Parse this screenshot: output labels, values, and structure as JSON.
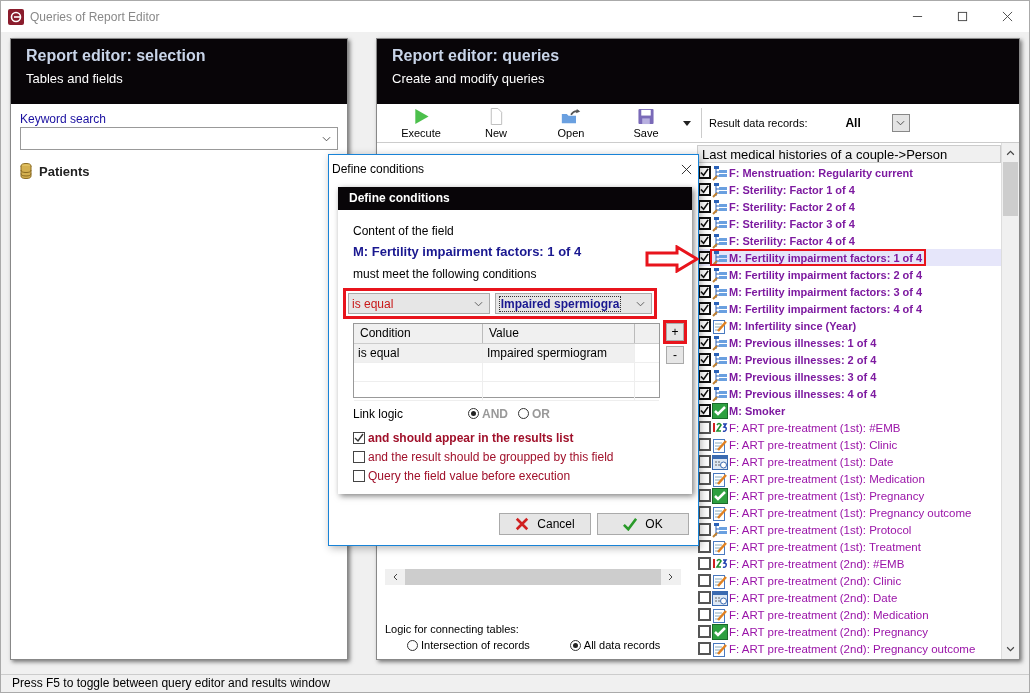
{
  "window": {
    "title": "Queries of Report Editor"
  },
  "selection_panel": {
    "title": "Report editor: selection",
    "subtitle": "Tables and fields",
    "keyword_search": {
      "label": "Keyword search"
    },
    "tables": [
      {
        "label": "Patients"
      }
    ]
  },
  "queries_panel": {
    "title": "Report editor: queries",
    "subtitle": "Create and modify queries",
    "toolbar": [
      {
        "label": "Execute",
        "kind": "run"
      },
      {
        "label": "New",
        "kind": "new"
      },
      {
        "label": "Open",
        "kind": "open"
      },
      {
        "label": "Save",
        "kind": "save"
      }
    ],
    "result_records": {
      "label": "Result data records:",
      "value": "All"
    },
    "connect_logic": {
      "label": "Logic for connecting tables:",
      "options": [
        {
          "label": "Intersection of records",
          "selected": false
        },
        {
          "label": "All data records",
          "selected": true
        }
      ]
    },
    "field_list": {
      "header": "Last medical histories of a couple->Person",
      "items": [
        {
          "label": "F: Menstruation: Regularity current",
          "kind": "list",
          "checked": true,
          "selected": false
        },
        {
          "label": "F: Sterility: Factor 1 of 4",
          "kind": "list",
          "checked": true,
          "selected": false
        },
        {
          "label": "F: Sterility: Factor 2 of 4",
          "kind": "list",
          "checked": true,
          "selected": false
        },
        {
          "label": "F: Sterility: Factor 3 of 4",
          "kind": "list",
          "checked": true,
          "selected": false
        },
        {
          "label": "F: Sterility: Factor 4 of 4",
          "kind": "list",
          "checked": true,
          "selected": false
        },
        {
          "label": "M: Fertility impairment factors: 1 of 4",
          "kind": "list",
          "checked": true,
          "selected": true,
          "annotated": true
        },
        {
          "label": "M: Fertility impairment factors: 2 of 4",
          "kind": "list",
          "checked": true,
          "selected": false
        },
        {
          "label": "M: Fertility impairment factors: 3 of 4",
          "kind": "list",
          "checked": true,
          "selected": false
        },
        {
          "label": "M: Fertility impairment factors: 4 of 4",
          "kind": "list",
          "checked": true,
          "selected": false
        },
        {
          "label": "M: Infertility since (Year)",
          "kind": "text",
          "checked": true,
          "selected": false
        },
        {
          "label": "M: Previous illnesses: 1 of 4",
          "kind": "list",
          "checked": true,
          "selected": false
        },
        {
          "label": "M: Previous illnesses: 2 of 4",
          "kind": "list",
          "checked": true,
          "selected": false
        },
        {
          "label": "M: Previous illnesses: 3 of 4",
          "kind": "list",
          "checked": true,
          "selected": false
        },
        {
          "label": "M: Previous illnesses: 4 of 4",
          "kind": "list",
          "checked": true,
          "selected": false
        },
        {
          "label": "M: Smoker",
          "kind": "yesno",
          "checked": true,
          "selected": false
        },
        {
          "label": "F: ART pre-treatment (1st): #EMB",
          "kind": "number",
          "checked": false,
          "selected": false
        },
        {
          "label": "F: ART pre-treatment (1st): Clinic",
          "kind": "text",
          "checked": false,
          "selected": false
        },
        {
          "label": "F: ART pre-treatment (1st): Date",
          "kind": "date",
          "checked": false,
          "selected": false
        },
        {
          "label": "F: ART pre-treatment (1st): Medication",
          "kind": "text",
          "checked": false,
          "selected": false
        },
        {
          "label": "F: ART pre-treatment (1st): Pregnancy",
          "kind": "yesno",
          "checked": false,
          "selected": false
        },
        {
          "label": "F: ART pre-treatment (1st): Pregnancy outcome",
          "kind": "text",
          "checked": false,
          "selected": false
        },
        {
          "label": "F: ART pre-treatment (1st): Protocol",
          "kind": "list",
          "checked": false,
          "selected": false
        },
        {
          "label": "F: ART pre-treatment (1st): Treatment",
          "kind": "text",
          "checked": false,
          "selected": false
        },
        {
          "label": "F: ART pre-treatment (2nd): #EMB",
          "kind": "number",
          "checked": false,
          "selected": false
        },
        {
          "label": "F: ART pre-treatment (2nd): Clinic",
          "kind": "text",
          "checked": false,
          "selected": false
        },
        {
          "label": "F: ART pre-treatment (2nd): Date",
          "kind": "date",
          "checked": false,
          "selected": false
        },
        {
          "label": "F: ART pre-treatment (2nd): Medication",
          "kind": "text",
          "checked": false,
          "selected": false
        },
        {
          "label": "F: ART pre-treatment (2nd): Pregnancy",
          "kind": "yesno",
          "checked": false,
          "selected": false
        },
        {
          "label": "F: ART pre-treatment (2nd): Pregnancy outcome",
          "kind": "text",
          "checked": false,
          "selected": false
        }
      ]
    }
  },
  "dialog": {
    "title": "Define conditions",
    "header": "Define conditions",
    "intro": "Content of the field",
    "field": "M: Fertility impairment factors: 1 of 4",
    "outro": "must meet the following conditions",
    "selectors": {
      "annotated": true,
      "operator": "is equal",
      "value": "Impaired spermiogra"
    },
    "conditions": {
      "columns": [
        "Condition",
        "Value"
      ],
      "rows": [
        {
          "condition": "is equal",
          "value": "Impaired spermiogram"
        }
      ]
    },
    "add_button": {
      "label": "+",
      "annotated": true
    },
    "remove_button": {
      "label": "-"
    },
    "link_logic": {
      "label": "Link logic",
      "disabled": true,
      "options": [
        {
          "label": "AND",
          "selected": true
        },
        {
          "label": "OR",
          "selected": false
        }
      ]
    },
    "options": [
      {
        "label": "and should appear in the results list",
        "checked": true
      },
      {
        "label": "and the result should be groupped by this field",
        "checked": false
      },
      {
        "label": "Query the field value before execution",
        "checked": false
      }
    ],
    "buttons": [
      {
        "label": "Cancel",
        "kind": "cancel"
      },
      {
        "label": "OK",
        "kind": "ok"
      }
    ]
  },
  "status_bar": "Press F5 to toggle between query editor and results window"
}
